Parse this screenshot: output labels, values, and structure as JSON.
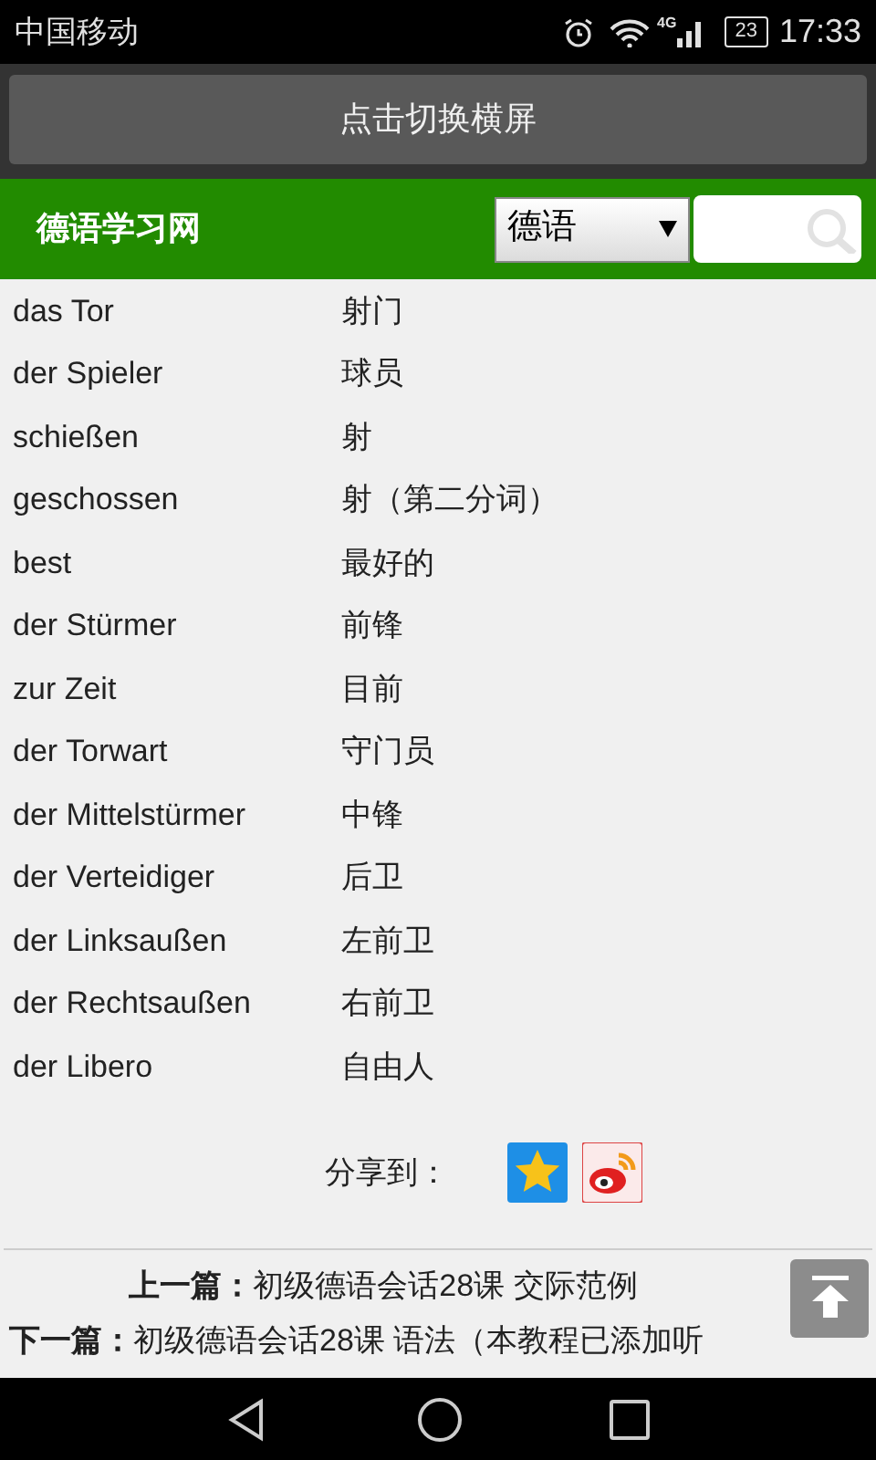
{
  "status_bar": {
    "carrier": "中国移动",
    "network": "4G",
    "battery": "23",
    "time": "17:33"
  },
  "rotate_button": "点击切换横屏",
  "header": {
    "site_name": "德语学习网",
    "language_select": "德语"
  },
  "words": [
    {
      "german": "das Tor",
      "chinese": "射门"
    },
    {
      "german": "der Spieler",
      "chinese": "球员"
    },
    {
      "german": "schießen",
      "chinese": "射"
    },
    {
      "german": "geschossen",
      "chinese": "射（第二分词）"
    },
    {
      "german": "best",
      "chinese": "最好的"
    },
    {
      "german": "der Stürmer",
      "chinese": "前锋"
    },
    {
      "german": "zur Zeit",
      "chinese": "目前"
    },
    {
      "german": "der Torwart",
      "chinese": "守门员"
    },
    {
      "german": "der Mittelstürmer",
      "chinese": "中锋"
    },
    {
      "german": "der Verteidiger",
      "chinese": "后卫"
    },
    {
      "german": "der Linksaußen",
      "chinese": "左前卫"
    },
    {
      "german": "der Rechtsaußen",
      "chinese": "右前卫"
    },
    {
      "german": "der Libero",
      "chinese": "自由人"
    }
  ],
  "share_label": "分享到：",
  "prev": {
    "label": "上一篇：",
    "title": "初级德语会话28课 交际范例"
  },
  "next": {
    "label": "下一篇：",
    "title": "初级德语会话28课 语法（本教程已添加听"
  }
}
